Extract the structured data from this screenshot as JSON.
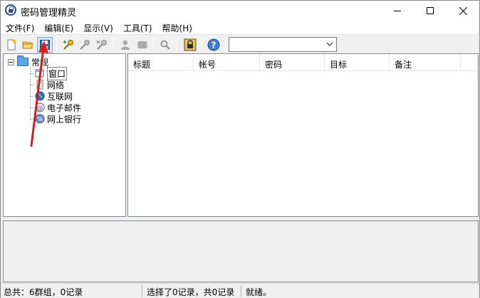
{
  "window": {
    "title": "密码管理精灵",
    "controls": {
      "minimize": "minimize-icon",
      "maximize": "maximize-icon",
      "close": "close-icon"
    }
  },
  "menu": {
    "items": [
      {
        "label": "文件(F)"
      },
      {
        "label": "编辑(E)"
      },
      {
        "label": "显示(V)"
      },
      {
        "label": "工具(T)"
      },
      {
        "label": "帮助(H)"
      }
    ]
  },
  "toolbar": {
    "buttons": [
      {
        "icon": "new-document-icon"
      },
      {
        "icon": "open-folder-icon"
      },
      {
        "icon": "save-icon",
        "active": true
      },
      {
        "icon": "add-key-icon"
      },
      {
        "icon": "edit-key-icon"
      },
      {
        "icon": "delete-key-icon"
      },
      {
        "icon": "user-icon"
      },
      {
        "icon": "card-icon"
      },
      {
        "icon": "search-icon"
      },
      {
        "icon": "lock-icon"
      },
      {
        "icon": "help-icon"
      }
    ],
    "combo_value": ""
  },
  "tree": {
    "root": {
      "label": "常规",
      "icon": "folder-icon",
      "expanded": true
    },
    "children": [
      {
        "label": "窗口",
        "icon": "window-icon",
        "selected": true
      },
      {
        "label": "网络",
        "icon": "network-icon"
      },
      {
        "label": "互联网",
        "icon": "globe-icon"
      },
      {
        "label": "电子邮件",
        "icon": "email-icon"
      },
      {
        "label": "网上银行",
        "icon": "bank-icon"
      }
    ]
  },
  "list": {
    "columns": [
      {
        "label": "标题"
      },
      {
        "label": "帐号"
      },
      {
        "label": "密码"
      },
      {
        "label": "目标"
      },
      {
        "label": "备注"
      }
    ]
  },
  "status": {
    "groups": "总共：6群组，0记录",
    "selection": "选择了0记录，共0记录",
    "state": "就绪。"
  },
  "colors": {
    "annotation_arrow": "#d42020",
    "accent": "#2b4a8a"
  }
}
